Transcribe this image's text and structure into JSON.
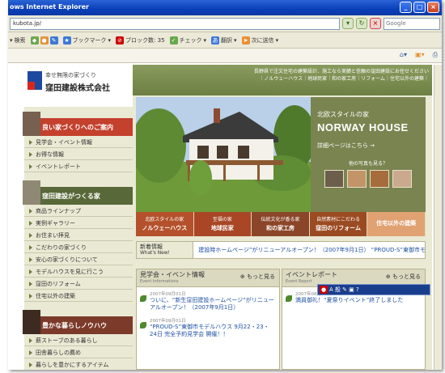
{
  "window": {
    "title": "ows Internet Explorer"
  },
  "address": {
    "url": "kubota.jp/",
    "search_placeholder": "Google"
  },
  "toolbar": {
    "search_label": "検索",
    "bookmark_label": "ブックマーク",
    "block_label": "ブロック数: 35",
    "check_label": "チェック",
    "translate_label": "翻訳",
    "send_label": "次に送信"
  },
  "site": {
    "tagline": "幸せ無限の家づくり",
    "company": "窪田建設株式会社",
    "top_text": "長野県で注文住宅の建築設計、施工なら実績と信頼の窪田建設にお任せください",
    "top_links": "｜ノルウェーハウス｜地球民家｜和の家工房｜リフォーム｜住宅以外の建築｜"
  },
  "side": {
    "sec1": "良い家づくりへのご案内",
    "menu1": [
      "見学会・イベント情報",
      "お得な情報",
      "イベントレポート"
    ],
    "sec2": "窪田建設がつくる家",
    "menu2": [
      "商品ラインナップ",
      "実例ギャラリー",
      "お住まい拝見",
      "こだわりの家づくり",
      "安心の家づくりについて",
      "モデルハウスを見に行こう",
      "窪田のリフォーム",
      "住宅以外の建築"
    ],
    "sec3": "豊かな暮らしノウハウ",
    "menu3": [
      "薪ストーブのある暮らし",
      "田舎暮らしの薦め",
      "暮らしを豊かにするアイテム"
    ]
  },
  "hero": {
    "north_label": "北欧スタイルの家",
    "title": "NORWAY HOUSE",
    "link": "詳細ページはこちら →",
    "others": "他の写真も見る？"
  },
  "categories": [
    {
      "sub": "北欧スタイルの家",
      "name": "ノルウェーハウス",
      "color": "#b4512c"
    },
    {
      "sub": "至福の家",
      "name": "地球民家",
      "color": "#a84626"
    },
    {
      "sub": "伝統文化が香る家",
      "name": "和の家工房",
      "color": "#8b4629"
    },
    {
      "sub": "自然素材にこだわる",
      "name": "窪田のリフォーム",
      "color": "#9b4b22"
    },
    {
      "sub": "",
      "name": "住宅以外の建築",
      "color": "#e0a273"
    }
  ],
  "news": {
    "label": "新着情報",
    "sub": "What's New!",
    "text": "建設時ホームページ”がリニューアルオープン！（2007年9月1日）   “PROUD-S”東御市モデ"
  },
  "events": {
    "title": "見学会・イベント情報",
    "sub": "Event Informations",
    "more": "もっと見る",
    "items": [
      {
        "date": "2007年09月01日",
        "text": "ついに、“新生窪田建設ホームページ”がリニューアルオープン！（2007年9月1日）"
      },
      {
        "date": "2007年09月01日",
        "text": "“PROUD-S”東御市モデルハウス 9月22・23・24日 完全予約見学会 開催！！"
      }
    ]
  },
  "reports": {
    "title": "イベントレポート",
    "sub": "Event Report",
    "more": "もっと見る",
    "items": [
      {
        "date": "2007年08月12日",
        "text": "満員御礼！“夏祭りイベント”終了しました"
      }
    ]
  },
  "ime": {
    "text": "A 般"
  }
}
